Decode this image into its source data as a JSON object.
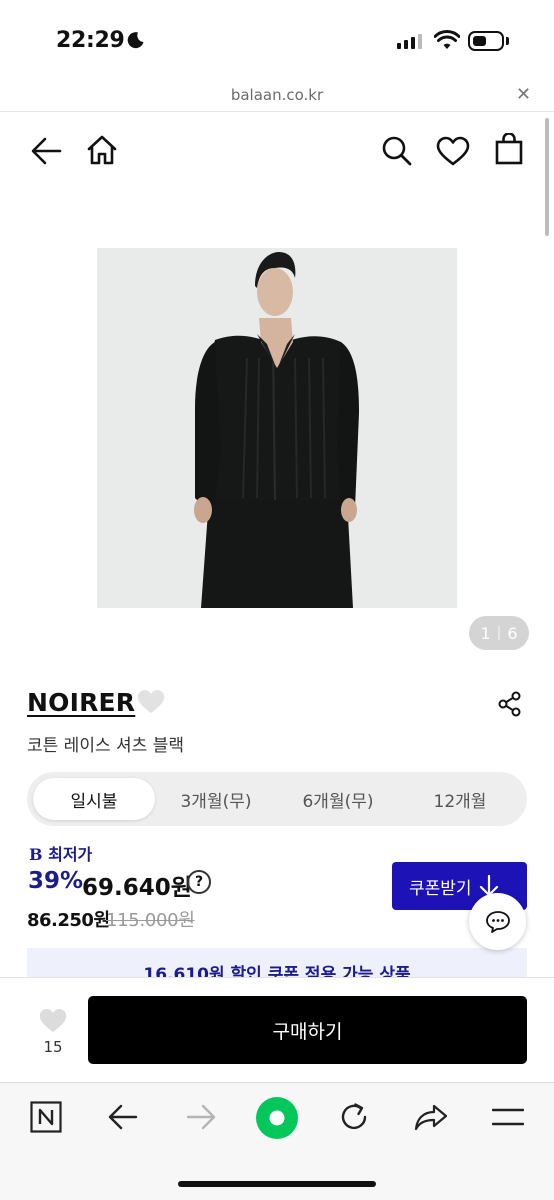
{
  "status_bar": {
    "time": "22:29"
  },
  "browser": {
    "url": "balaan.co.kr",
    "close_label": "✕"
  },
  "gallery": {
    "current": "1",
    "separator": "|",
    "total": "6"
  },
  "product": {
    "brand": "NOIRER",
    "name": "코튼 레이스 셔츠 블랙"
  },
  "installment_tabs": [
    "일시불",
    "3개월(무)",
    "6개월(무)",
    "12개월"
  ],
  "price": {
    "best_label": "최저가",
    "best_label_icon": "B",
    "discount_rate": "39%",
    "sale_price": "69.640원",
    "help_label": "?",
    "member_price": "86.250원",
    "original_price": "115.000원"
  },
  "coupon": {
    "button_label": "쿠폰받기",
    "banner_text": "16.610원 할인 쿠폰 적용 가능 상품"
  },
  "purchase_bar": {
    "like_count": "15",
    "buy_label": "구매하기"
  },
  "colors": {
    "accent_navy": "#1d1d8a",
    "coupon_button": "#1d12b5",
    "naver_green": "#03c75a"
  },
  "icons": {
    "header": [
      "back-arrow-icon",
      "home-icon",
      "search-icon",
      "heart-icon",
      "shopping-bag-icon"
    ],
    "toolbar": [
      "naver-n-icon",
      "back-icon",
      "forward-icon",
      "green-dot-icon",
      "refresh-icon",
      "share-icon",
      "menu-icon"
    ]
  }
}
